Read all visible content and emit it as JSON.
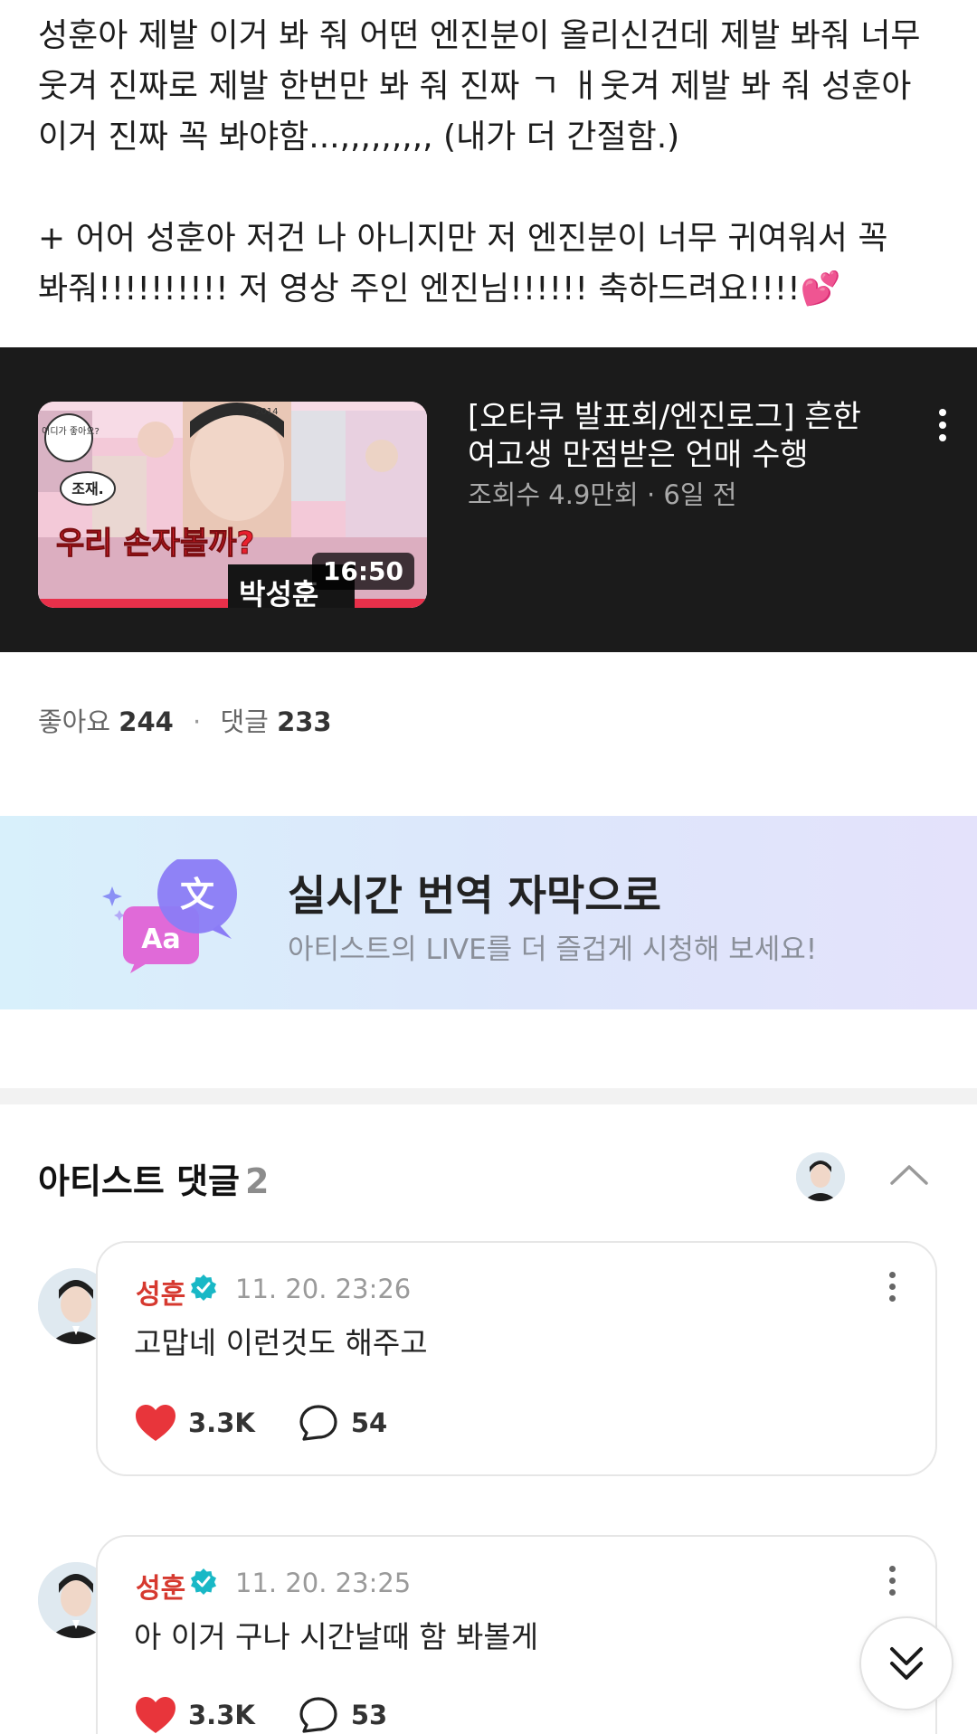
{
  "post": {
    "paragraph1": "성훈아 제발 이거 봐 줘 어떤 엔진분이 올리신건데 제발 봐줘 너무\n웃겨 진짜로 제발 한번만 봐 줘 진짜 ㄱ ㅐ웃겨 제발 봐 줘 성훈아\n이거 진짜 꼭 봐야함...,,,,,,,,, (내가 더 간절함.)",
    "paragraph2": "+ 어어 성훈아 저건 나 아니지만 저 엔진분이 너무 귀여워서 꼭\n봐줘!!!!!!!!!! 저 영상 주인 엔진님!!!!!! 축하드려요!!!!",
    "emoji": "💕"
  },
  "video": {
    "title": "[오타쿠 발표회/엔진로그] 흔한 여고생 만점받은 언매 수행",
    "meta": "조회수 4.9만회 · 6일 전",
    "duration": "16:50",
    "thumb_bubble": "어디가 좋아요?",
    "thumb_label": "조재.",
    "thumb_caption": "우리 손자볼까?",
    "thumb_year": "2014",
    "thumb_bottom": "박성훈"
  },
  "stats": {
    "likes_label": "좋아요",
    "likes": "244",
    "separator": "·",
    "comments_label": "댓글",
    "comments": "233"
  },
  "banner": {
    "title": "실시간 번역 자막으로",
    "subtitle": "아티스트의 LIVE를 더 즐겁게 시청해 보세요!",
    "icon_glyph": "文",
    "icon_letters": "Aa"
  },
  "artist_comments": {
    "heading": "아티스트 댓글",
    "count": "2",
    "items": [
      {
        "name": "성훈",
        "time": "11. 20. 23:26",
        "text": "고맙네 이런것도 해주고",
        "likes": "3.3K",
        "replies": "54"
      },
      {
        "name": "성훈",
        "time": "11. 20. 23:25",
        "text": "아 이거 구나 시간날때 함 봐볼게",
        "likes": "3.3K",
        "replies": "53"
      }
    ]
  },
  "colors": {
    "video_bg": "#1b1b1b",
    "name_red": "#d6392f",
    "verified_teal": "#19b8c6",
    "like_red": "#e8353b",
    "banner_purple": "#8b7cf6"
  },
  "icons": [
    "more-vertical-icon",
    "translate-icon",
    "chevron-up-icon",
    "verified-icon",
    "heart-icon",
    "comment-bubble-icon",
    "double-chevron-down-icon"
  ]
}
